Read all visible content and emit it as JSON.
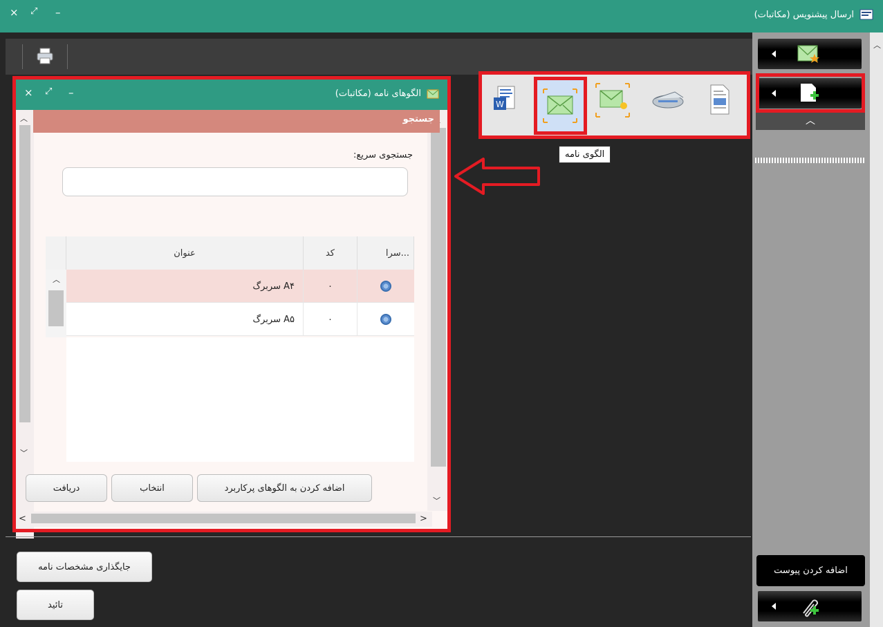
{
  "window": {
    "title": "ارسال پیشنویس (مکاتبات)",
    "controls": {
      "close": "×",
      "maximize": "⤢",
      "minimize": "–"
    }
  },
  "icon_panel": {
    "tooltip": "الگوی نامه",
    "icons": [
      "document-icon",
      "scanner-icon",
      "envelope-idea-icon",
      "letter-template-icon",
      "word-document-icon"
    ]
  },
  "sidebar": {
    "tooltip": "اضافه کردن پیوست",
    "buttons": [
      "favorite-letter-icon",
      "add-new-icon",
      "attach-file-icon"
    ]
  },
  "dialog": {
    "title": "الگوهای نامه (مکاتبات)",
    "search_header": "جستجو",
    "quick_search_label": "جستجوی سریع:",
    "search_placeholder": "",
    "table": {
      "columns": [
        "سرا...",
        "کد",
        "عنوان"
      ],
      "rows": [
        {
          "code": "۰",
          "title": "سربرگ A۴",
          "selected": true
        },
        {
          "code": "۰",
          "title": "سربرگ A۵",
          "selected": false
        }
      ]
    },
    "buttons": {
      "add_frequent": "اضافه کردن به الگوهای پرکاربرد",
      "select": "انتخاب",
      "receive": "دریافت"
    }
  },
  "footer": {
    "placement_button": "جایگذاری مشخصات نامه",
    "confirm_button": "تائید"
  },
  "colors": {
    "titlebar": "#2f9b83",
    "highlight": "#e41b23",
    "search_header": "#d4887d",
    "selected_row": "#f6dcd9"
  }
}
